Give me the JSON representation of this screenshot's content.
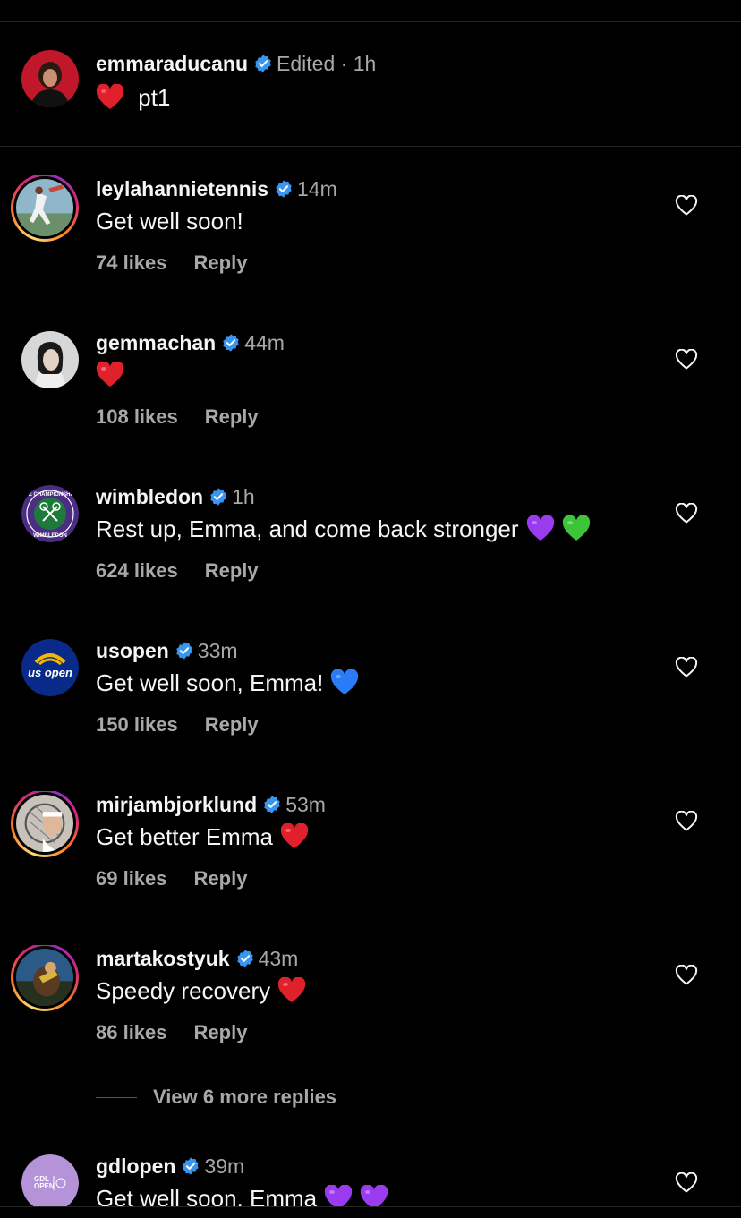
{
  "post": {
    "username": "emmaraducanu",
    "edited": "Edited",
    "time": "1h",
    "caption": "pt1",
    "emoji": "red-heart"
  },
  "comments": [
    {
      "username": "leylahannietennis",
      "time": "14m",
      "text": "Get well soon!",
      "emojis": [],
      "likes": "74 likes",
      "reply": "Reply"
    },
    {
      "username": "gemmachan",
      "time": "44m",
      "text": "",
      "emojis": [
        "red-heart"
      ],
      "likes": "108 likes",
      "reply": "Reply"
    },
    {
      "username": "wimbledon",
      "time": "1h",
      "text": "Rest up, Emma, and come back stronger",
      "emojis": [
        "purple-heart",
        "green-heart"
      ],
      "likes": "624 likes",
      "reply": "Reply"
    },
    {
      "username": "usopen",
      "time": "33m",
      "text": "Get well soon, Emma!",
      "emojis": [
        "blue-heart"
      ],
      "likes": "150 likes",
      "reply": "Reply"
    },
    {
      "username": "mirjambjorklund",
      "time": "53m",
      "text": "Get better Emma",
      "emojis": [
        "red-heart"
      ],
      "likes": "69 likes",
      "reply": "Reply"
    },
    {
      "username": "martakostyuk",
      "time": "43m",
      "text": "Speedy recovery",
      "emojis": [
        "red-heart"
      ],
      "likes": "86 likes",
      "reply": "Reply"
    },
    {
      "username": "gdlopen",
      "time": "39m",
      "text": "Get well soon, Emma",
      "emojis": [
        "purple-heart",
        "purple-heart"
      ],
      "likes": "",
      "reply": ""
    }
  ],
  "view_more": "View 6 more replies",
  "avatar_logos": {
    "usopen": "us open",
    "wimbledon": [
      "THE CHAMPIONSHIPS",
      "WIMBLEDON"
    ],
    "gdlopen": [
      "GDL",
      "OPEN"
    ]
  },
  "colors": {
    "verified": "#3797f0",
    "muted": "#a8a8a8",
    "background": "#000000",
    "red_heart": "#e0202b",
    "purple_heart": "#9b3bef",
    "green_heart": "#3ec43a",
    "blue_heart": "#2a7cf6"
  }
}
